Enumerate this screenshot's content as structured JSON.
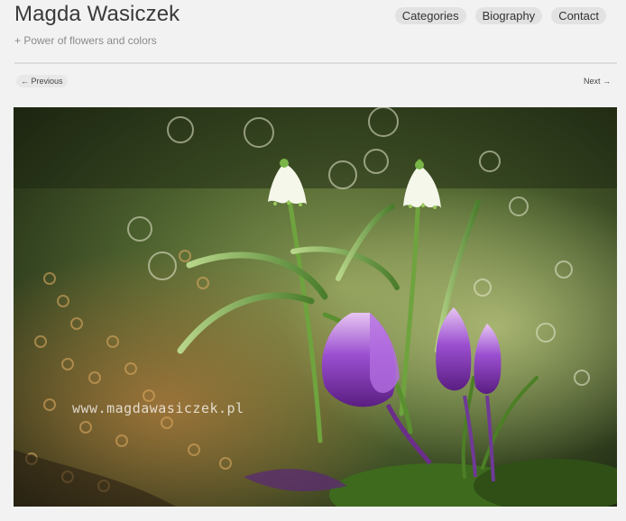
{
  "header": {
    "title": "Magda Wasiczek",
    "tagline": "+ Power of flowers and colors"
  },
  "nav": {
    "items": [
      {
        "label": "Categories"
      },
      {
        "label": "Biography"
      },
      {
        "label": "Contact"
      }
    ]
  },
  "pager": {
    "previous": "← Previous",
    "next": "Next →"
  },
  "photo": {
    "watermark": "www.magdawasiczek.pl",
    "subject": "snowdrops-and-purple-crocuses"
  },
  "colors": {
    "background": "#f2f2f2",
    "nav_pill": "#e2e2e2",
    "crocus": "#8a3ec0",
    "foliage": "#3d6b2a"
  }
}
